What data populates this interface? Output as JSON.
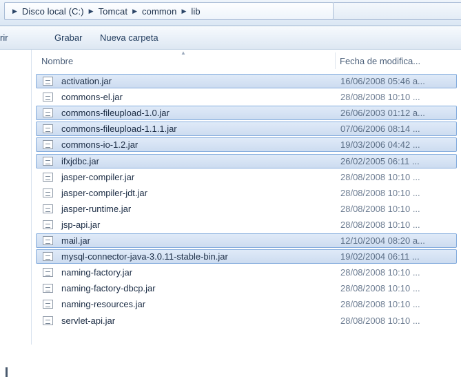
{
  "breadcrumb": [
    "Disco local (C:)",
    "Tomcat",
    "common",
    "lib"
  ],
  "toolbar": {
    "left_fragment": "rir",
    "burn_label": "Grabar",
    "new_folder_label": "Nueva carpeta"
  },
  "columns": {
    "name": "Nombre",
    "date": "Fecha de modifica..."
  },
  "files": [
    {
      "name": "activation.jar",
      "date": "16/06/2008 05:46 a...",
      "selected": true
    },
    {
      "name": "commons-el.jar",
      "date": "28/08/2008 10:10 ...",
      "selected": false
    },
    {
      "name": "commons-fileupload-1.0.jar",
      "date": "26/06/2003 01:12 a...",
      "selected": true
    },
    {
      "name": "commons-fileupload-1.1.1.jar",
      "date": "07/06/2006 08:14 ...",
      "selected": true
    },
    {
      "name": "commons-io-1.2.jar",
      "date": "19/03/2006 04:42 ...",
      "selected": true
    },
    {
      "name": "ifxjdbc.jar",
      "date": "26/02/2005 06:11 ...",
      "selected": true
    },
    {
      "name": "jasper-compiler.jar",
      "date": "28/08/2008 10:10 ...",
      "selected": false
    },
    {
      "name": "jasper-compiler-jdt.jar",
      "date": "28/08/2008 10:10 ...",
      "selected": false
    },
    {
      "name": "jasper-runtime.jar",
      "date": "28/08/2008 10:10 ...",
      "selected": false
    },
    {
      "name": "jsp-api.jar",
      "date": "28/08/2008 10:10 ...",
      "selected": false
    },
    {
      "name": "mail.jar",
      "date": "12/10/2004 08:20 a...",
      "selected": true
    },
    {
      "name": "mysql-connector-java-3.0.11-stable-bin.jar",
      "date": "19/02/2004 06:11 ...",
      "selected": true
    },
    {
      "name": "naming-factory.jar",
      "date": "28/08/2008 10:10 ...",
      "selected": false
    },
    {
      "name": "naming-factory-dbcp.jar",
      "date": "28/08/2008 10:10 ...",
      "selected": false
    },
    {
      "name": "naming-resources.jar",
      "date": "28/08/2008 10:10 ...",
      "selected": false
    },
    {
      "name": "servlet-api.jar",
      "date": "28/08/2008 10:10 ...",
      "selected": false
    }
  ]
}
